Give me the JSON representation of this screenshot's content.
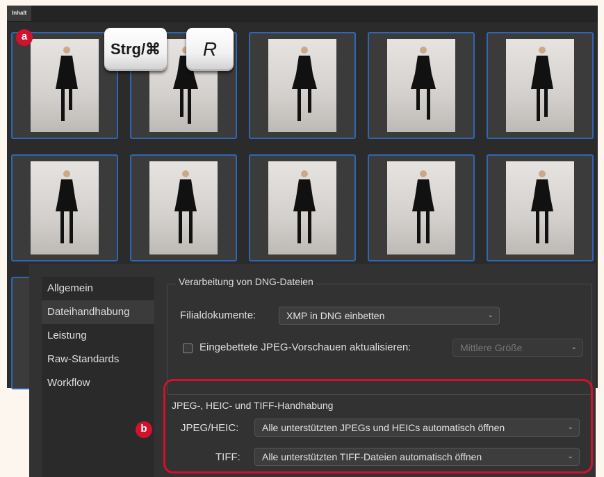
{
  "tab_label": "Inhalt",
  "keys": {
    "ctrl": "Strg/⌘",
    "r": "R"
  },
  "badges": {
    "a": "a",
    "b": "b"
  },
  "sidebar": {
    "items": [
      {
        "label": "Allgemein"
      },
      {
        "label": "Dateihandhabung"
      },
      {
        "label": "Leistung"
      },
      {
        "label": "Raw-Standards"
      },
      {
        "label": "Workflow"
      }
    ]
  },
  "dng_section": {
    "title": "Verarbeitung von DNG-Dateien",
    "filial_label": "Filialdokumente:",
    "filial_value": "XMP in DNG einbetten",
    "jpeg_preview_label": "Eingebettete JPEG-Vorschauen aktualisieren:",
    "jpeg_preview_value": "Mittlere Größe",
    "jpeg_preview_checked": false
  },
  "jpeg_section": {
    "title": "JPEG-, HEIC- und TIFF-Handhabung",
    "jpeg_label": "JPEG/HEIC:",
    "jpeg_value": "Alle unterstützten JPEGs und HEICs automatisch öffnen",
    "tiff_label": "TIFF:",
    "tiff_value": "Alle unterstützten TIFF-Dateien automatisch öffnen"
  },
  "colors": {
    "accent_red": "#d2112d",
    "selection_blue": "#2f67b5"
  },
  "icons": {
    "select_chevron": "chevron-down-icon"
  }
}
